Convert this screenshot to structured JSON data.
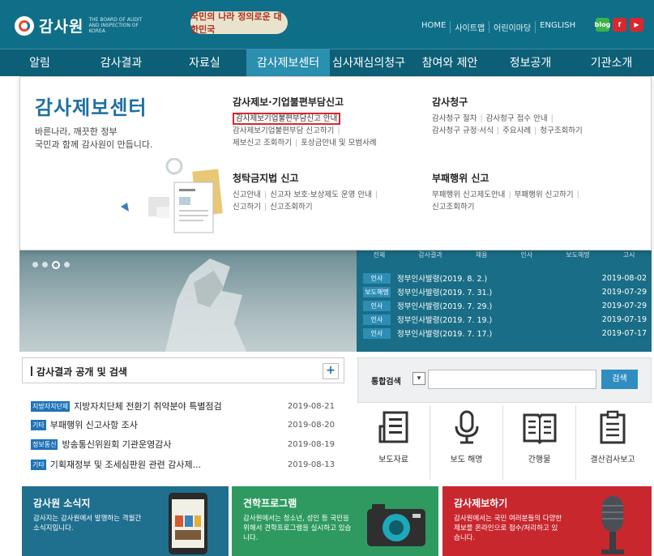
{
  "header": {
    "site_name": "감사원",
    "site_name_en": "THE BOARD OF AUDIT AND INSPECTION OF KOREA",
    "slogan": "국민의 나라 정의로운 대한민국",
    "util_links": [
      "HOME",
      "사이트맵",
      "어린이마당",
      "ENGLISH"
    ],
    "sns": [
      {
        "label": "blog",
        "icon": "blog-icon",
        "color": "#3cb34a"
      },
      {
        "label": "f",
        "icon": "facebook-icon",
        "color": "#d9272e"
      },
      {
        "label": "▶",
        "icon": "youtube-icon",
        "color": "#d9272e"
      }
    ]
  },
  "gnb": [
    "알림",
    "감사결과",
    "자료실",
    "감사제보센터",
    "심사재심의청구",
    "참여와 제안",
    "정보공개",
    "기관소개"
  ],
  "gnb_active": "감사제보센터",
  "dropdown": {
    "title": "감사제보센터",
    "desc1": "바른나라, 깨끗한 정부",
    "desc2": "국민과 함께 감사원이 만듭니다.",
    "sections": [
      {
        "title": "감사제보·기업불편부담신고",
        "rows": [
          [
            "감사제보기업불편부담신고 안내"
          ],
          [
            "감사제보기업불편부담 신고하기"
          ],
          [
            "제보신고 조회하기",
            "포상금안내 및 모범사례"
          ]
        ]
      },
      {
        "title": "감사청구",
        "rows": [
          [
            "감사청구 절차",
            "감사청구 접수 안내"
          ],
          [
            "감사청구 규정·서식",
            "주요사례",
            "청구조회하기"
          ]
        ]
      },
      {
        "title": "청탁금지법 신고",
        "rows": [
          [
            "신고안내",
            "신고자 보호·보상제도 운영 안내"
          ],
          [
            "신고하기",
            "신고조회하기"
          ]
        ]
      },
      {
        "title": "부패행위 신고",
        "rows": [
          [
            "부패행위 신고제도안내",
            "부패행위 신고하기"
          ],
          [
            "신고조회하기"
          ]
        ]
      }
    ]
  },
  "news_tabs": [
    "전체",
    "감사결과",
    "채용",
    "인사",
    "보도해명",
    "고시"
  ],
  "news": [
    {
      "cat": "인사",
      "title": "정부인사발령(2019. 8. 2.)",
      "date": "2019-08-02"
    },
    {
      "cat": "보도해명",
      "title": "정부인사발령(2019. 7. 31.)",
      "date": "2019-07-29"
    },
    {
      "cat": "인사",
      "title": "정부인사발령(2019. 7. 29.)",
      "date": "2019-07-29"
    },
    {
      "cat": "인사",
      "title": "정부인사발령(2019. 7. 19.)",
      "date": "2019-07-19"
    },
    {
      "cat": "인사",
      "title": "정부인사발령(2019. 7. 17.)",
      "date": "2019-07-17"
    }
  ],
  "results": {
    "title": "감사결과 공개 및 검색",
    "plus": "+",
    "items": [
      {
        "tag": "지방자치단체",
        "title": "지방자치단체 전환기 취약분야 특별점검",
        "date": "2019-08-21"
      },
      {
        "tag": "기타",
        "title": "부패행위 신고사항 조사",
        "date": "2019-08-20"
      },
      {
        "tag": "정보통신",
        "title": "방송통신위원회 기관운영감사",
        "date": "2019-08-19"
      },
      {
        "tag": "기타",
        "title": "기획재정부 및 조세심판원 관련 감사제...",
        "date": "2019-08-13"
      }
    ]
  },
  "unified_search": {
    "label": "통합검색",
    "select_glyph": "▾",
    "button": "검색"
  },
  "tiles": [
    {
      "label": "보도자료",
      "icon": "newspaper-icon"
    },
    {
      "label": "보도 해명",
      "icon": "microphone-icon"
    },
    {
      "label": "간행물",
      "icon": "book-icon"
    },
    {
      "label": "결산검사보고",
      "icon": "clipboard-icon"
    }
  ],
  "banners": [
    {
      "title": "감사원 소식지",
      "text": "감사지는 감사원에서 발행하는 격월간 소식지입니다.",
      "color": "#1f6f8f"
    },
    {
      "title": "견학프로그램",
      "text": "감사원에서는 청소년, 성인 등 국민을 위해서 견학프로그램을 실시하고 있습니다.",
      "color": "#2e9a5f"
    },
    {
      "title": "감사제보하기",
      "text": "감사원에서는 국민 여러분들의 다양한 제보를 온라인으로 접수/처리하고 있습니다.",
      "color": "#c9272e"
    }
  ]
}
